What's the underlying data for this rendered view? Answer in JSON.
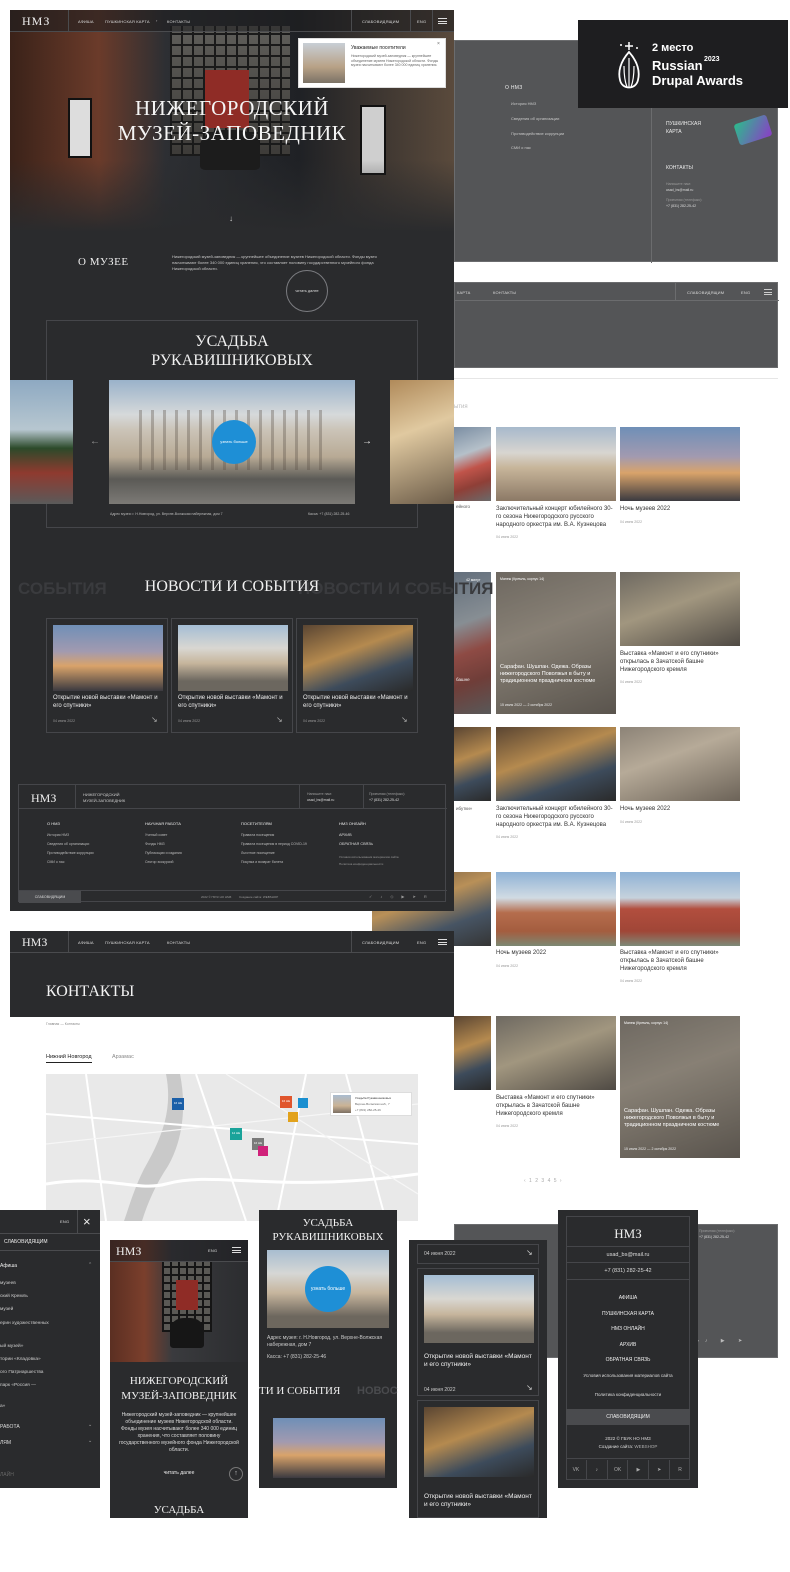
{
  "logo": "НМЗ",
  "nav": {
    "afisha": "АФИША",
    "pushkin": "ПУШКИНСКАЯ КАРТА",
    "contacts": "КОНТАКТЫ",
    "impaired": "СЛАБОВИДЯЩИМ",
    "lang": "ENG"
  },
  "hero": {
    "title_line1": "НИЖЕГОРОДСКИЙ",
    "title_line2": "МУЗЕЙ-ЗАПОВЕДНИК"
  },
  "notice": {
    "title": "Уважаемые посетители",
    "text": "Нижегородский музей-заповедник — крупнейшее объединение музеев Нижегородской области. Фонды музея насчитывают более 340 000 единиц хранения."
  },
  "about": {
    "heading": "О МУЗЕЕ",
    "text": "Нижегородский музей-заповедник — крупнейшее объединение музеев Нижегородской области. Фонды музея насчитывают более 340 000 единиц хранения, что составляет половину государственного музейного фонда Нижегородской области.",
    "more": "читать далее"
  },
  "estate": {
    "title_line1": "УСАДЬБА",
    "title_line2": "РУКАВИШНИКОВЫХ",
    "more": "узнать больше",
    "address": "Адрес музея: г. Н.Новгород, ул. Верхне-Волжская набережная, дом 7",
    "cashier": "Касса: +7 (831) 282-25-46"
  },
  "events": {
    "heading": "НОВОСТИ И СОБЫТИЯ",
    "ghost": "СОБЫТИЯ",
    "ghost_right": "НОВОСТИ И СОБЫТИЯ",
    "cards": [
      {
        "title": "Открытие новой выставки «Мамонт и его спутники»",
        "date": "04 июня 2022"
      },
      {
        "title": "Открытие новой выставки «Мамонт и его спутники»",
        "date": "04 июня 2022"
      },
      {
        "title": "Открытие новой выставки «Мамонт и его спутники»",
        "date": "04 июня 2022"
      }
    ]
  },
  "footer": {
    "logo": "НМЗ",
    "museum_name_line1": "НИЖЕГОРОДСКИЙ",
    "museum_name_line2": "МУЗЕЙ-ЗАПОВЕДНИК",
    "write": "Напишите нам:",
    "email": "usad_bs@mail.ru",
    "reception": "Приемная (телефакс):",
    "phone": "+7 (831) 282-25-42",
    "cols": [
      {
        "title": "О НМЗ",
        "items": [
          "История НМЗ",
          "Сведения об организации",
          "Противодействие коррупции",
          "СМИ о нас"
        ]
      },
      {
        "title": "НАУЧНАЯ РАБОТА",
        "items": [
          "Ученый совет",
          "Фонды НМЗ",
          "Публикации и издания",
          "Сектор экскурсий"
        ]
      },
      {
        "title": "ПОСЕТИТЕЛЯМ",
        "items": [
          "Правила посещения",
          "Правила посещения в период COVID-19",
          "Льготное посещение",
          "Покупка и возврат билета"
        ]
      },
      {
        "title": "НМЗ ОНЛАЙН",
        "items": [
          "АРХИВ",
          "ОБРАТНАЯ СВЯЗЬ",
          "Условия использования материалов сайта",
          "Политика конфиденциальности"
        ]
      }
    ],
    "impaired": "СЛАБОВИДЯЩИМ",
    "copyright": "2022 © ГБУК НО НМЗ",
    "creator": "Создание сайта: WEBSHOP"
  },
  "contacts": {
    "title": "КОНТАКТЫ",
    "breadcrumb_home": "Главная",
    "breadcrumb_sep": "—",
    "breadcrumb_current": "Контакты",
    "tab1": "Нижний Новгород",
    "tab2": "Арзамас",
    "markers": [
      {
        "label": "16 НЕ",
        "color": "#1a5fa8"
      },
      {
        "label": "16 НЕ",
        "color": "#e0552c"
      },
      {
        "label": "12 НЕ",
        "color": "#1aa39a"
      },
      {
        "label": "16 НЕ",
        "color": "#7a7a7a"
      },
      {
        "label": "",
        "color": "#e2a21c"
      },
      {
        "label": "",
        "color": "#1a8fd0"
      },
      {
        "label": "",
        "color": "#d0217a"
      }
    ],
    "popup_title": "Усадьба Рукавишниковых",
    "popup_addr": "Верхне-Волжская наб., 7",
    "popup_phone": "+7 (831) 282-25-46"
  },
  "award": {
    "place": "2 место",
    "line1": "Russian",
    "year": "2023",
    "line2": "Drupal Awards"
  },
  "right": {
    "about_heading": "О НМЗ",
    "about_items": [
      "История НМЗ",
      "Сведения об организации",
      "Противодействие коррупции",
      "СМИ о нас"
    ],
    "pushkin": "ПУШКИНСКАЯ КАРТА",
    "contacts_heading": "КОНТАКТЫ",
    "write": "Напишите нам:",
    "email": "usad_bs@mail.ru",
    "reception": "Приемная (телефакс):",
    "phone": "+7 (831) 282-25-42",
    "nav_pushkin": "КАРТА",
    "nav_contacts": "КОНТАКТЫ",
    "nav_impaired": "СЛАБОВИДЯЩИМ",
    "nav_lang": "ENG",
    "section": "ытия",
    "grid": [
      {
        "title": "Заключительный концерт юбилейного 30-го сезона Нижегородского русского народного оркестра им. В.А. Кузнецова",
        "date": "04 июня 2022"
      },
      {
        "title": "Ночь музеев 2022",
        "date": "04 июня 2022"
      },
      {
        "title": "Сарафан. Шушпан. Одежа. Образы нижегородского Поволжья в быту и традиционном праздничном костюме",
        "date": "15 июля 2022 — 2 октября 2022",
        "tag": "Манеж (Кремль, корпус 14)"
      },
      {
        "title": "Выставка «Мамонт и его спутники» открылась в Зачатской башне Нижегородского кремля",
        "date": "04 июня 2022"
      },
      {
        "title": "Заключительный концерт юбилейного 30-го сезона Нижегородского русского народного оркестра им. В.А. Кузнецова",
        "date": "04 июня 2022"
      },
      {
        "title": "Ночь музеев 2022",
        "date": "04 июня 2022"
      },
      {
        "title": "Ночь музеев 2022",
        "date": "04 июня 2022"
      },
      {
        "title": "Выставка «Мамонт и его спутники» открылась в Зачатской башне Нижегородского кремля",
        "date": "04 июня 2022"
      },
      {
        "title": "Выставка «Мамонт и его спутники» открылась в Зачатской башне Нижегородского кремля",
        "date": "04 июня 2022"
      },
      {
        "title": "Сарафан. Шушпан. Одежа. Образы нижегородского Поволжья в быту и традиционном праздничном костюме",
        "date": "15 июля 2022 — 2 октября 2022",
        "tag": "Манеж (Кремль, корпус 14)"
      }
    ],
    "left_tag": "42 минут",
    "left_labels": [
      "ейного",
      "ибутки»",
      "башне"
    ],
    "pager": "‹  1  2  3  4  5  ›",
    "footer_reception": "Приемная (телефакс):",
    "footer_phone": "+7 (831) 282-25-42"
  },
  "mobile1": {
    "lang": "ENG",
    "impaired": "СЛАБОВИДЯЩИМ",
    "items": [
      "Афиша",
      "музеев",
      "ский Кремль",
      "музей",
      "ерин художественных",
      "ый музей»",
      "тории «Кладовка»",
      "ого Патриаршества",
      "парк «Россия —",
      "а»",
      "РАБОТА",
      "ЛЯМ",
      "ЛАЙН"
    ]
  },
  "mobile2": {
    "logo": "НМЗ",
    "lang": "ENG",
    "title_line1": "НИЖЕГОРОДСКИЙ",
    "title_line2": "МУЗЕЙ-ЗАПОВЕДНИК",
    "text": "Нижегородский музей-заповедник — крупнейшее объединение музеев Нижегородской области. Фонды музея насчитывают более 340 000 единиц хранения, что составляет половину государственного музейного фонда Нижегородской области.",
    "more": "читать далее",
    "next": "УСАДЬБА"
  },
  "mobile3": {
    "title_line1": "УСАДЬБА",
    "title_line2": "РУКАВИШНИКОВЫХ",
    "more": "узнать больше",
    "address": "Адрес музея: г. Н.Новгород, ул. Верхне-Волжская набережная, дом 7",
    "cashier": "Касса: +7 (831) 282-25-46",
    "ghost": "ТИ И СОБЫТИЯ",
    "ghost2": "НОВОС"
  },
  "mobile4": {
    "date1": "04 июня 2022",
    "title1": "Открытие новой выставки «Мамонт и его спутники»",
    "date2": "04 июня 2022",
    "title2": "Открытие новой выставки «Мамонт и его спутники»"
  },
  "mobile5": {
    "logo": "НМЗ",
    "email": "usad_bs@mail.ru",
    "phone": "+7 (831) 282-25-42",
    "items": [
      "АФИША",
      "ПУШКИНСКАЯ КАРТА",
      "НМЗ ОНЛАЙН",
      "АРХИВ",
      "ОБРАТНАЯ СВЯЗЬ"
    ],
    "terms": "Условия использования материалов сайта",
    "privacy": "Политика конфиденциальности",
    "impaired": "СЛАБОВИДЯЩИМ",
    "copyright": "2022 © ГБУК НО НМЗ",
    "creator": "Создание сайта:",
    "creator_name": "WEBSHOP",
    "socials": [
      "VK",
      "♪",
      "OK",
      "▶",
      "➤",
      "R"
    ]
  }
}
